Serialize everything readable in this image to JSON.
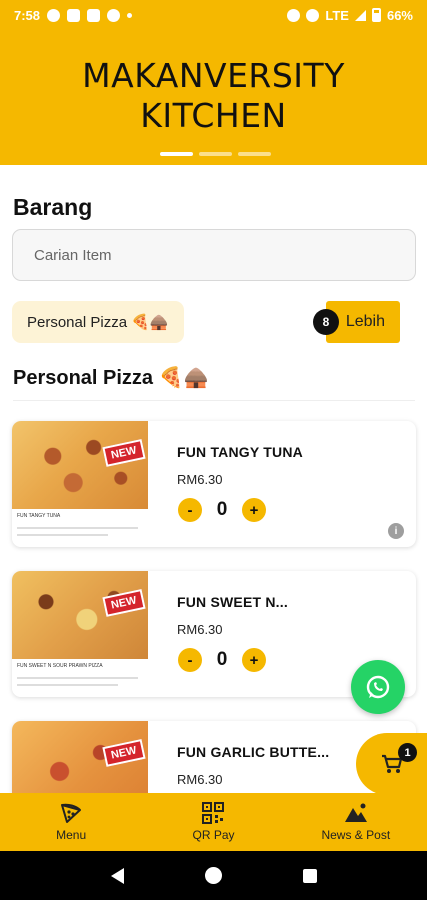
{
  "status_bar": {
    "time": "7:58",
    "network": "LTE",
    "battery": "66%"
  },
  "header": {
    "brand_line1": "MAKANVERSITY",
    "brand_line2": "KITCHEN",
    "carousel_pages": 3,
    "carousel_active": 1
  },
  "section_title": "Barang",
  "search": {
    "placeholder": "Carian Item",
    "value": ""
  },
  "category_chip": "Personal Pizza 🍕🛖",
  "more_button": {
    "label": "Lebih",
    "badge": "8"
  },
  "category_title": "Personal Pizza 🍕🛖",
  "items": [
    {
      "name": "FUN TANGY TUNA",
      "price": "RM6.30",
      "quantity": "0",
      "minus": "-",
      "plus": "+",
      "badge": "NEW",
      "thumb_caption": "FUN TANGY TUNA"
    },
    {
      "name": "FUN SWEET N...",
      "price": "RM6.30",
      "quantity": "0",
      "minus": "-",
      "plus": "+",
      "badge": "NEW",
      "thumb_caption": "FUN SWEET N SOUR PRAWN PIZZA"
    },
    {
      "name": "FUN GARLIC BUTTE...",
      "price": "RM6.30",
      "quantity": "",
      "minus": "",
      "plus": "",
      "badge": "NEW",
      "thumb_caption": ""
    }
  ],
  "cart": {
    "badge": "1"
  },
  "bottom_nav": [
    {
      "label": "Menu",
      "icon": "pizza-slice-icon"
    },
    {
      "label": "QR Pay",
      "icon": "qr-code-icon"
    },
    {
      "label": "News & Post",
      "icon": "mountains-icon"
    }
  ],
  "colors": {
    "brand": "#f5b800",
    "whatsapp": "#25d366",
    "new_tag": "#d4242c"
  }
}
